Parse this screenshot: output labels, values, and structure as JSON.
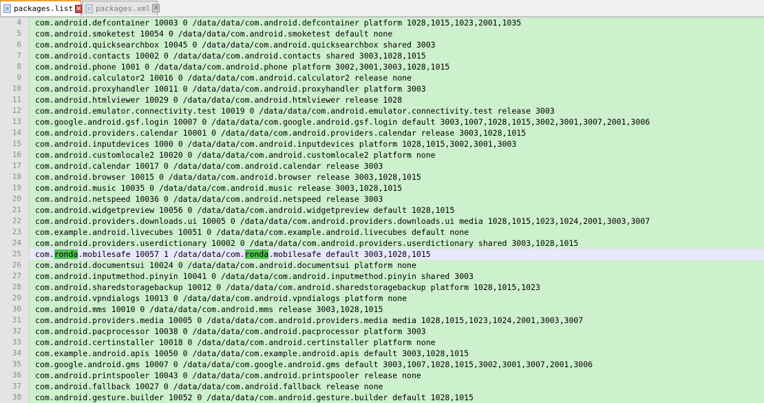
{
  "tabs": [
    {
      "label": "packages.list",
      "active": true
    },
    {
      "label": "packages.xml",
      "active": false
    }
  ],
  "highlight_term": "ronda",
  "colors": {
    "selection_bg": "#cdf0cd",
    "current_line_bg": "#e8e8ff",
    "match_bg": "#4ec34e"
  },
  "lines": [
    {
      "n": "4",
      "text": "com.android.defcontainer 10003 0 /data/data/com.android.defcontainer platform 1028,1015,1023,2001,1035"
    },
    {
      "n": "5",
      "text": "com.android.smoketest 10054 0 /data/data/com.android.smoketest default none"
    },
    {
      "n": "6",
      "text": "com.android.quicksearchbox 10045 0 /data/data/com.android.quicksearchbox shared 3003"
    },
    {
      "n": "7",
      "text": "com.android.contacts 10002 0 /data/data/com.android.contacts shared 3003,1028,1015"
    },
    {
      "n": "8",
      "text": "com.android.phone 1001 0 /data/data/com.android.phone platform 3002,3001,3003,1028,1015"
    },
    {
      "n": "9",
      "text": "com.android.calculator2 10016 0 /data/data/com.android.calculator2 release none"
    },
    {
      "n": "10",
      "text": "com.android.proxyhandler 10011 0 /data/data/com.android.proxyhandler platform 3003"
    },
    {
      "n": "11",
      "text": "com.android.htmlviewer 10029 0 /data/data/com.android.htmlviewer release 1028"
    },
    {
      "n": "12",
      "text": "com.android.emulator.connectivity.test 10019 0 /data/data/com.android.emulator.connectivity.test release 3003"
    },
    {
      "n": "13",
      "text": "com.google.android.gsf.login 10007 0 /data/data/com.google.android.gsf.login default 3003,1007,1028,1015,3002,3001,3007,2001,3006"
    },
    {
      "n": "14",
      "text": "com.android.providers.calendar 10001 0 /data/data/com.android.providers.calendar release 3003,1028,1015"
    },
    {
      "n": "15",
      "text": "com.android.inputdevices 1000 0 /data/data/com.android.inputdevices platform 1028,1015,3002,3001,3003"
    },
    {
      "n": "16",
      "text": "com.android.customlocale2 10020 0 /data/data/com.android.customlocale2 platform none"
    },
    {
      "n": "17",
      "text": "com.android.calendar 10017 0 /data/data/com.android.calendar release 3003"
    },
    {
      "n": "18",
      "text": "com.android.browser 10015 0 /data/data/com.android.browser release 3003,1028,1015"
    },
    {
      "n": "19",
      "text": "com.android.music 10035 0 /data/data/com.android.music release 3003,1028,1015"
    },
    {
      "n": "20",
      "text": "com.android.netspeed 10036 0 /data/data/com.android.netspeed release 3003"
    },
    {
      "n": "21",
      "text": "com.android.widgetpreview 10056 0 /data/data/com.android.widgetpreview default 1028,1015"
    },
    {
      "n": "22",
      "text": "com.android.providers.downloads.ui 10005 0 /data/data/com.android.providers.downloads.ui media 1028,1015,1023,1024,2001,3003,3007"
    },
    {
      "n": "23",
      "text": "com.example.android.livecubes 10051 0 /data/data/com.example.android.livecubes default none"
    },
    {
      "n": "24",
      "text": "com.android.providers.userdictionary 10002 0 /data/data/com.android.providers.userdictionary shared 3003,1028,1015"
    },
    {
      "n": "25",
      "text": "com.ronda.mobilesafe 10057 1 /data/data/com.ronda.mobilesafe default 3003,1028,1015",
      "current": true
    },
    {
      "n": "26",
      "text": "com.android.documentsui 10024 0 /data/data/com.android.documentsui platform none"
    },
    {
      "n": "27",
      "text": "com.android.inputmethod.pinyin 10041 0 /data/data/com.android.inputmethod.pinyin shared 3003"
    },
    {
      "n": "28",
      "text": "com.android.sharedstoragebackup 10012 0 /data/data/com.android.sharedstoragebackup platform 1028,1015,1023"
    },
    {
      "n": "29",
      "text": "com.android.vpndialogs 10013 0 /data/data/com.android.vpndialogs platform none"
    },
    {
      "n": "30",
      "text": "com.android.mms 10010 0 /data/data/com.android.mms release 3003,1028,1015"
    },
    {
      "n": "31",
      "text": "com.android.providers.media 10005 0 /data/data/com.android.providers.media media 1028,1015,1023,1024,2001,3003,3007"
    },
    {
      "n": "32",
      "text": "com.android.pacprocessor 10038 0 /data/data/com.android.pacprocessor platform 3003"
    },
    {
      "n": "33",
      "text": "com.android.certinstaller 10018 0 /data/data/com.android.certinstaller platform none"
    },
    {
      "n": "34",
      "text": "com.example.android.apis 10050 0 /data/data/com.example.android.apis default 3003,1028,1015"
    },
    {
      "n": "35",
      "text": "com.google.android.gms 10007 0 /data/data/com.google.android.gms default 3003,1007,1028,1015,3002,3001,3007,2001,3006"
    },
    {
      "n": "36",
      "text": "com.android.printspooler 10043 0 /data/data/com.android.printspooler release none"
    },
    {
      "n": "37",
      "text": "com.android.fallback 10027 0 /data/data/com.android.fallback release none"
    },
    {
      "n": "38",
      "text": "com.android.gesture.builder 10052 0 /data/data/com.android.gesture.builder default 1028,1015"
    }
  ]
}
